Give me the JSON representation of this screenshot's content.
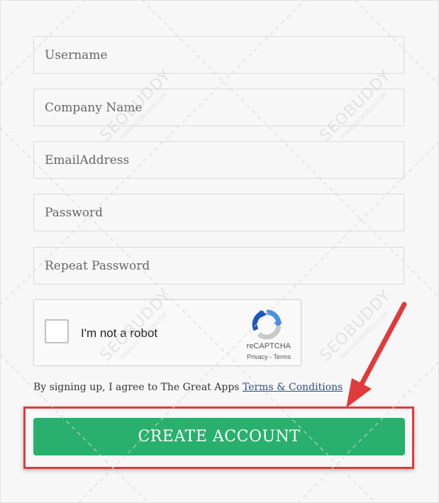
{
  "form": {
    "fields": [
      {
        "placeholder": "Username"
      },
      {
        "placeholder": "Company Name"
      },
      {
        "placeholder": "EmailAddress"
      },
      {
        "placeholder": "Password"
      },
      {
        "placeholder": "Repeat Password"
      }
    ],
    "captcha": {
      "label": "I'm not a robot",
      "brand": "reCAPTCHA",
      "privacy": "Privacy",
      "separator": " - ",
      "terms": "Terms"
    },
    "agree_text": "By signing up, I agree to The Great Apps ",
    "agree_link": "Terms & Conditions",
    "submit_label": "CREATE ACCOUNT"
  },
  "watermark": {
    "brand": "SEOBUDDY",
    "site": "WWW.SEOBUDDY.COM"
  },
  "colors": {
    "button": "#29b06d",
    "annotation": "#e03b3b",
    "link": "#2a4d8f"
  },
  "annotation_icon": "arrow-icon"
}
